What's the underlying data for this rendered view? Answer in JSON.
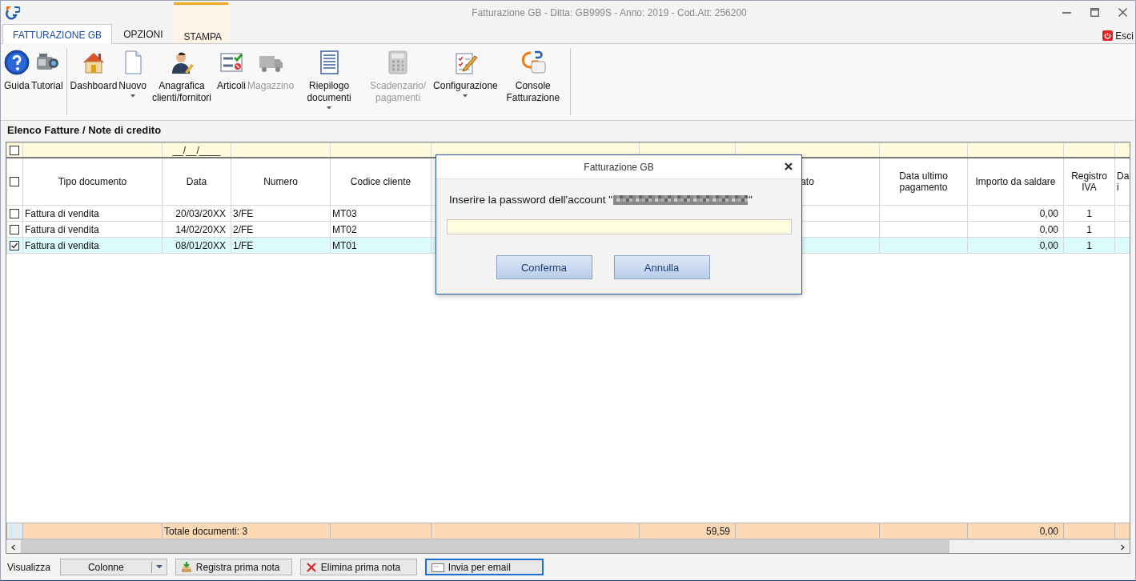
{
  "window": {
    "title": "Fatturazione GB - Ditta: GB999S - Anno: 2019 - Cod.Att: 256200"
  },
  "tabs": [
    {
      "label": "FATTURAZIONE GB",
      "selected": true,
      "contextual": false
    },
    {
      "label": "OPZIONI",
      "selected": false,
      "contextual": false
    },
    {
      "label": "STAMPA",
      "selected": false,
      "contextual": true
    }
  ],
  "exit_button": {
    "label": "Esci"
  },
  "ribbon": {
    "groups": [
      {
        "items": [
          {
            "label": "Guida",
            "kind": "help",
            "disabled": false,
            "dropdown": false
          },
          {
            "label": "Tutorial",
            "kind": "camera",
            "disabled": false,
            "dropdown": false
          }
        ]
      },
      {
        "items": [
          {
            "label": "Dashboard",
            "kind": "house",
            "disabled": false,
            "dropdown": false
          },
          {
            "label": "Nuovo",
            "kind": "page",
            "disabled": false,
            "dropdown": true
          },
          {
            "label": "Anagrafica clienti/fornitori",
            "kind": "person",
            "disabled": false,
            "dropdown": false
          },
          {
            "label": "Articoli",
            "kind": "checklist",
            "disabled": false,
            "dropdown": false
          },
          {
            "label": "Magazzino",
            "kind": "truck",
            "disabled": true,
            "dropdown": false
          },
          {
            "label": "Riepilogo documenti",
            "kind": "list",
            "disabled": false,
            "dropdown": true
          },
          {
            "label": "Scadenzario/ pagamenti",
            "kind": "calculator",
            "disabled": true,
            "dropdown": false
          },
          {
            "label": "Configurazione",
            "kind": "pencil",
            "disabled": false,
            "dropdown": true
          },
          {
            "label": "Console Fatturazione",
            "kind": "sdi",
            "disabled": false,
            "dropdown": false
          }
        ]
      }
    ]
  },
  "list_title": "Elenco Fatture / Note di credito",
  "table": {
    "select_all_checked": false,
    "filter_row": {
      "checked": false,
      "date_mask": "__/__/____"
    },
    "columns": [
      "Tipo documento",
      "Data",
      "Numero",
      "Codice cliente",
      null,
      null,
      "ato",
      "Data ultimo pagamento",
      "Importo da saldare",
      "Registro IVA",
      "Da i"
    ],
    "rows": [
      {
        "checked": false,
        "selected": false,
        "cells": [
          "Fattura di vendita",
          "20/03/20XX",
          "3/FE",
          "MT03",
          null,
          null,
          null,
          null,
          "0,00",
          "1",
          null
        ]
      },
      {
        "checked": false,
        "selected": false,
        "cells": [
          "Fattura di vendita",
          "14/02/20XX",
          "2/FE",
          "MT02",
          null,
          null,
          null,
          null,
          "0,00",
          "1",
          null
        ]
      },
      {
        "checked": true,
        "selected": true,
        "cells": [
          "Fattura di vendita",
          "08/01/20XX",
          "1/FE",
          "MT01",
          null,
          null,
          null,
          null,
          "0,00",
          "1",
          null
        ]
      }
    ],
    "totals": {
      "label": "Totale documenti: 3",
      "cells": [
        null,
        null,
        "59,59",
        null,
        null,
        "0,00",
        null,
        null
      ]
    }
  },
  "dialog": {
    "title": "Fatturazione GB",
    "prompt": "Inserire la password dell'account \"",
    "prompt_end": "\"",
    "redacted": true,
    "buttons": [
      "Conferma",
      "Annulla"
    ]
  },
  "bottom_bar": {
    "view_label": "Visualizza",
    "columns_dropdown": "Colonne",
    "buttons": [
      {
        "label": "Registra prima nota",
        "kind": "register",
        "focused": false
      },
      {
        "label": "Elimina prima nota",
        "kind": "delete",
        "focused": false
      },
      {
        "label": "Invia per email",
        "kind": "email",
        "focused": true
      }
    ]
  }
}
